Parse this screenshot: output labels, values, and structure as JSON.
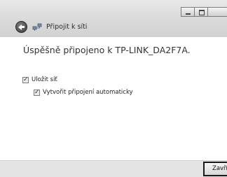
{
  "window": {
    "title": "Připojit k síti"
  },
  "main": {
    "heading": "Úspěšně připojeno k TP-LINK_DA2F7A.",
    "options": [
      {
        "label": "Uložit síť",
        "checked": true
      },
      {
        "label": "Vytvořit připojení automaticky",
        "checked": true
      }
    ]
  },
  "footer": {
    "close_label": "Zavřít"
  },
  "icons": {
    "back": "back-arrow-icon",
    "network": "network-icon",
    "minimize": "minimize-icon",
    "maximize": "maximize-icon",
    "close": "close-icon"
  }
}
